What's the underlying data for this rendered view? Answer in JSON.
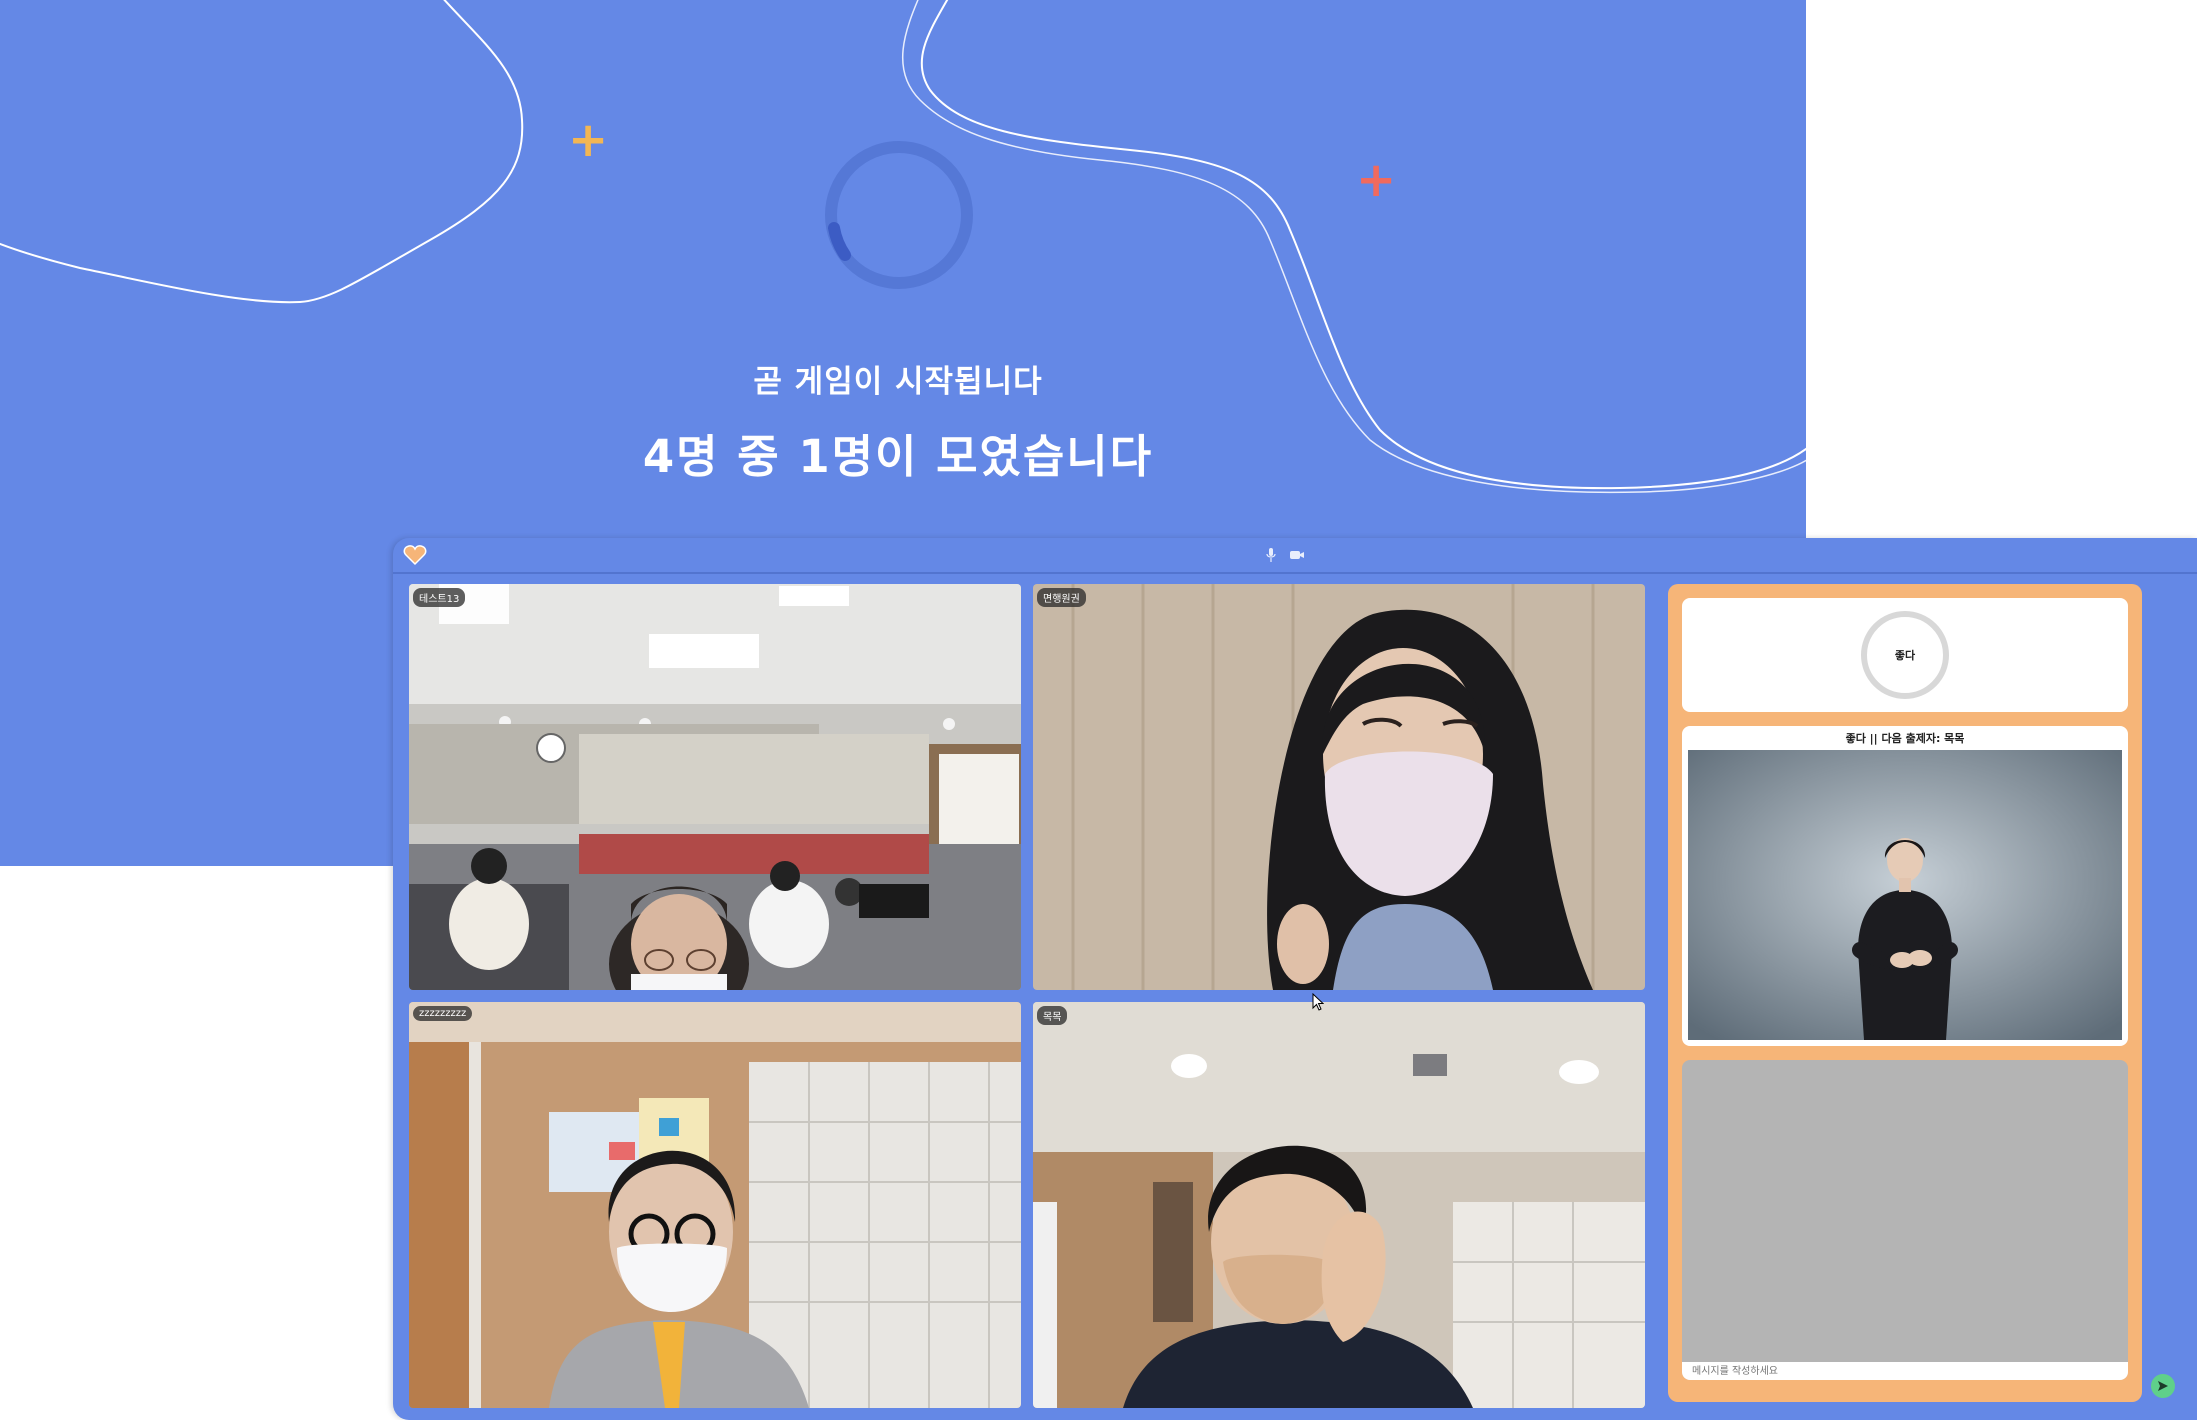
{
  "colors": {
    "background_blue": "#6488e6",
    "panel_orange": "#f6b578",
    "sparkle_yellow": "#f2b654",
    "sparkle_red": "#f06a5e",
    "send_green": "#5fd08a"
  },
  "waiting": {
    "line1": "곧 게임이 시작됩니다",
    "line2": "4명 중 1명이 모였습니다"
  },
  "participants": [
    {
      "name": "테스트13"
    },
    {
      "name": "면행원권"
    },
    {
      "name": "zzzzzzzzz"
    },
    {
      "name": "목목"
    }
  ],
  "side_panel": {
    "timer_word": "좋다",
    "sign_caption": "좋다 || 다음 출제자: 목목",
    "chat_placeholder": "메시지를 작성하세요"
  },
  "icons": {
    "logo": "heart-logo-icon",
    "mic": "microphone-icon",
    "camera": "camera-icon",
    "send": "send-arrow-icon",
    "cursor": "mouse-pointer-icon"
  }
}
